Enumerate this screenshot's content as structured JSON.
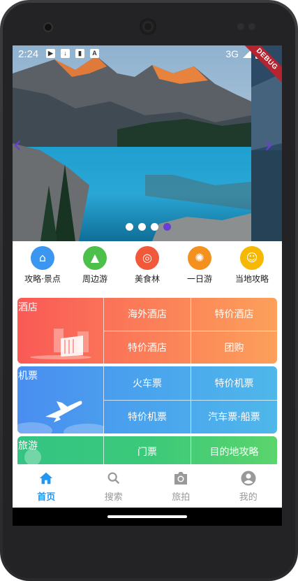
{
  "status_bar": {
    "time": "2:24",
    "network": "3G",
    "debug_ribbon": "DEBUG",
    "left_icons": [
      "play-protect-icon",
      "download-icon",
      "sd-card-icon",
      "a-icon"
    ]
  },
  "banner": {
    "slide_count": 4,
    "active_index": 3,
    "prev_glyph": "‹",
    "next_glyph": "›"
  },
  "quick_menu": [
    {
      "label": "攻略·景点",
      "color": "#3a96f0",
      "icon": "pavilion-icon"
    },
    {
      "label": "周边游",
      "color": "#4cc04a",
      "icon": "mountain-icon"
    },
    {
      "label": "美食林",
      "color": "#f2583a",
      "icon": "food-icon"
    },
    {
      "label": "一日游",
      "color": "#f4901e",
      "icon": "sun-icon"
    },
    {
      "label": "当地攻略",
      "color": "#f6b800",
      "icon": "local-guide-icon"
    }
  ],
  "grid": {
    "hotel": {
      "title": "酒店",
      "cells": [
        "海外酒店",
        "特价酒店",
        "特价酒店",
        "团购"
      ],
      "colors": [
        "#fa5956",
        "#fca05a"
      ]
    },
    "flight": {
      "title": "机票",
      "cells": [
        "火车票",
        "特价机票",
        "特价机票",
        "汽车票·船票"
      ],
      "colors": [
        "#4a8ef0",
        "#4fb7ea"
      ]
    },
    "travel": {
      "title": "旅游",
      "cells": [
        "门票",
        "目的地攻略"
      ],
      "colors": [
        "#34c483",
        "#5bd46c"
      ]
    }
  },
  "bottom_nav": [
    {
      "label": "首页",
      "icon": "home-icon",
      "active": true
    },
    {
      "label": "搜索",
      "icon": "search-icon",
      "active": false
    },
    {
      "label": "旅拍",
      "icon": "camera-icon",
      "active": false
    },
    {
      "label": "我的",
      "icon": "account-icon",
      "active": false
    }
  ],
  "colors": {
    "accent": "#2196f3",
    "indicator": "#6a3fd0",
    "inactive": "#999999"
  }
}
